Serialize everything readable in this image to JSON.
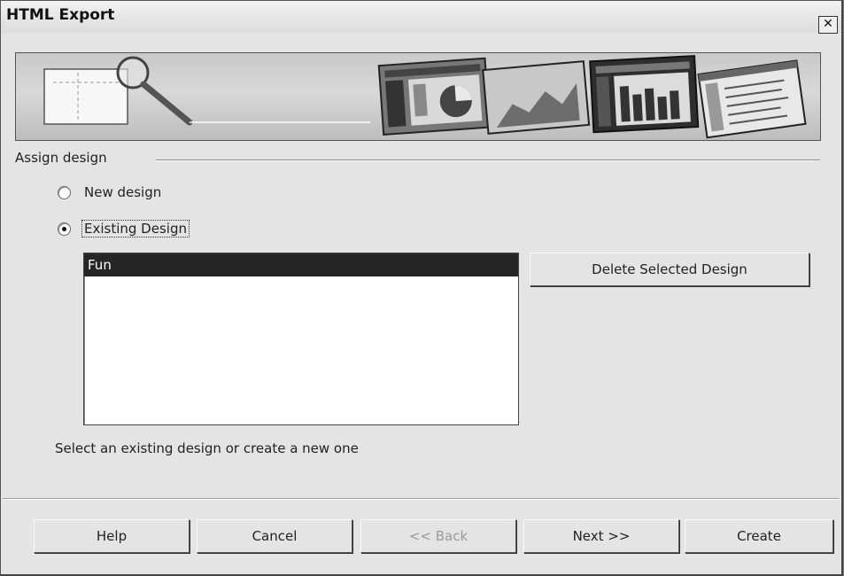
{
  "window": {
    "title": "HTML Export",
    "close_symbol": "✕"
  },
  "section": {
    "label": "Assign design"
  },
  "options": {
    "new_design": "New design",
    "existing_design": "Existing Design"
  },
  "designs": [
    "Fun"
  ],
  "delete_button": "Delete Selected Design",
  "hint": "Select an existing design or create a new one",
  "footer": {
    "help": "Help",
    "cancel": "Cancel",
    "back": "<< Back",
    "next": "Next >>",
    "create": "Create"
  }
}
